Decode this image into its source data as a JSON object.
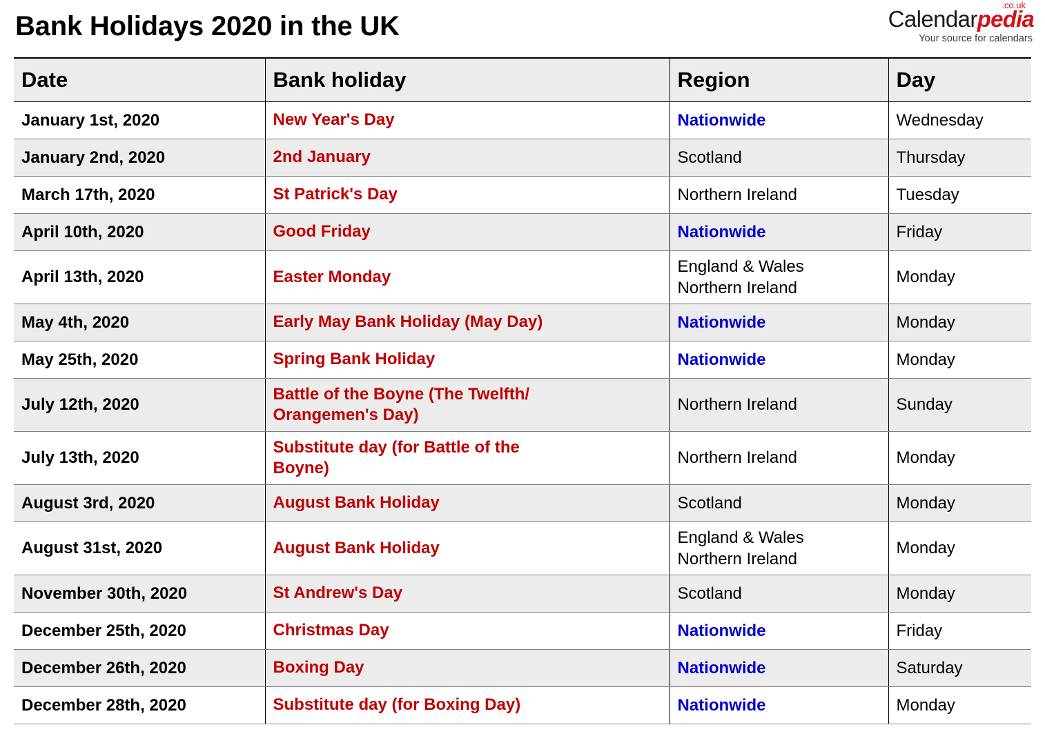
{
  "header": {
    "title": "Bank Holidays 2020 in the UK",
    "logo": {
      "part1": "Calendar",
      "part2": "pedia",
      "tld": ".co.uk",
      "tagline": "Your source for calendars"
    }
  },
  "colors": {
    "holiday_red": "#C00000",
    "nationwide_blue": "#0000CC",
    "header_background": "#ECECEC",
    "row_stripe": "#ECECEC",
    "logo_red": "#D41116"
  },
  "table": {
    "columns": [
      "Date",
      "Bank holiday",
      "Region",
      "Day"
    ],
    "rows": [
      {
        "date": "January 1st, 2020",
        "holiday_line1": "New Year's Day",
        "holiday_line2": "",
        "region_line1": "Nationwide",
        "region_line2": "",
        "nationwide": true,
        "day": "Wednesday"
      },
      {
        "date": "January 2nd, 2020",
        "holiday_line1": "2nd January",
        "holiday_line2": "",
        "region_line1": "Scotland",
        "region_line2": "",
        "nationwide": false,
        "day": "Thursday"
      },
      {
        "date": "March 17th, 2020",
        "holiday_line1": "St Patrick's Day",
        "holiday_line2": "",
        "region_line1": "Northern Ireland",
        "region_line2": "",
        "nationwide": false,
        "day": "Tuesday"
      },
      {
        "date": "April 10th, 2020",
        "holiday_line1": "Good Friday",
        "holiday_line2": "",
        "region_line1": "Nationwide",
        "region_line2": "",
        "nationwide": true,
        "day": "Friday"
      },
      {
        "date": "April 13th, 2020",
        "holiday_line1": "Easter Monday",
        "holiday_line2": "",
        "region_line1": "England & Wales",
        "region_line2": "Northern Ireland",
        "nationwide": false,
        "day": "Monday"
      },
      {
        "date": "May 4th, 2020",
        "holiday_line1": "Early May Bank Holiday (May Day)",
        "holiday_line2": "",
        "region_line1": "Nationwide",
        "region_line2": "",
        "nationwide": true,
        "day": "Monday"
      },
      {
        "date": "May 25th, 2020",
        "holiday_line1": "Spring Bank Holiday",
        "holiday_line2": "",
        "region_line1": "Nationwide",
        "region_line2": "",
        "nationwide": true,
        "day": "Monday"
      },
      {
        "date": "July 12th, 2020",
        "holiday_line1": "Battle of the Boyne (The Twelfth/",
        "holiday_line2": "Orangemen's Day)",
        "region_line1": "Northern Ireland",
        "region_line2": "",
        "nationwide": false,
        "day": "Sunday"
      },
      {
        "date": "July 13th, 2020",
        "holiday_line1": "Substitute day (for Battle of the",
        "holiday_line2": "Boyne)",
        "region_line1": "Northern Ireland",
        "region_line2": "",
        "nationwide": false,
        "day": "Monday"
      },
      {
        "date": "August 3rd, 2020",
        "holiday_line1": "August Bank Holiday",
        "holiday_line2": "",
        "region_line1": "Scotland",
        "region_line2": "",
        "nationwide": false,
        "day": "Monday"
      },
      {
        "date": "August 31st, 2020",
        "holiday_line1": "August Bank Holiday",
        "holiday_line2": "",
        "region_line1": "England & Wales",
        "region_line2": "Northern Ireland",
        "nationwide": false,
        "day": "Monday"
      },
      {
        "date": "November 30th, 2020",
        "holiday_line1": "St Andrew's Day",
        "holiday_line2": "",
        "region_line1": "Scotland",
        "region_line2": "",
        "nationwide": false,
        "day": "Monday"
      },
      {
        "date": "December 25th, 2020",
        "holiday_line1": "Christmas Day",
        "holiday_line2": "",
        "region_line1": "Nationwide",
        "region_line2": "",
        "nationwide": true,
        "day": "Friday"
      },
      {
        "date": "December 26th, 2020",
        "holiday_line1": "Boxing Day",
        "holiday_line2": "",
        "region_line1": "Nationwide",
        "region_line2": "",
        "nationwide": true,
        "day": "Saturday"
      },
      {
        "date": "December 28th, 2020",
        "holiday_line1": "Substitute day (for Boxing Day)",
        "holiday_line2": "",
        "region_line1": "Nationwide",
        "region_line2": "",
        "nationwide": true,
        "day": "Monday"
      }
    ]
  }
}
